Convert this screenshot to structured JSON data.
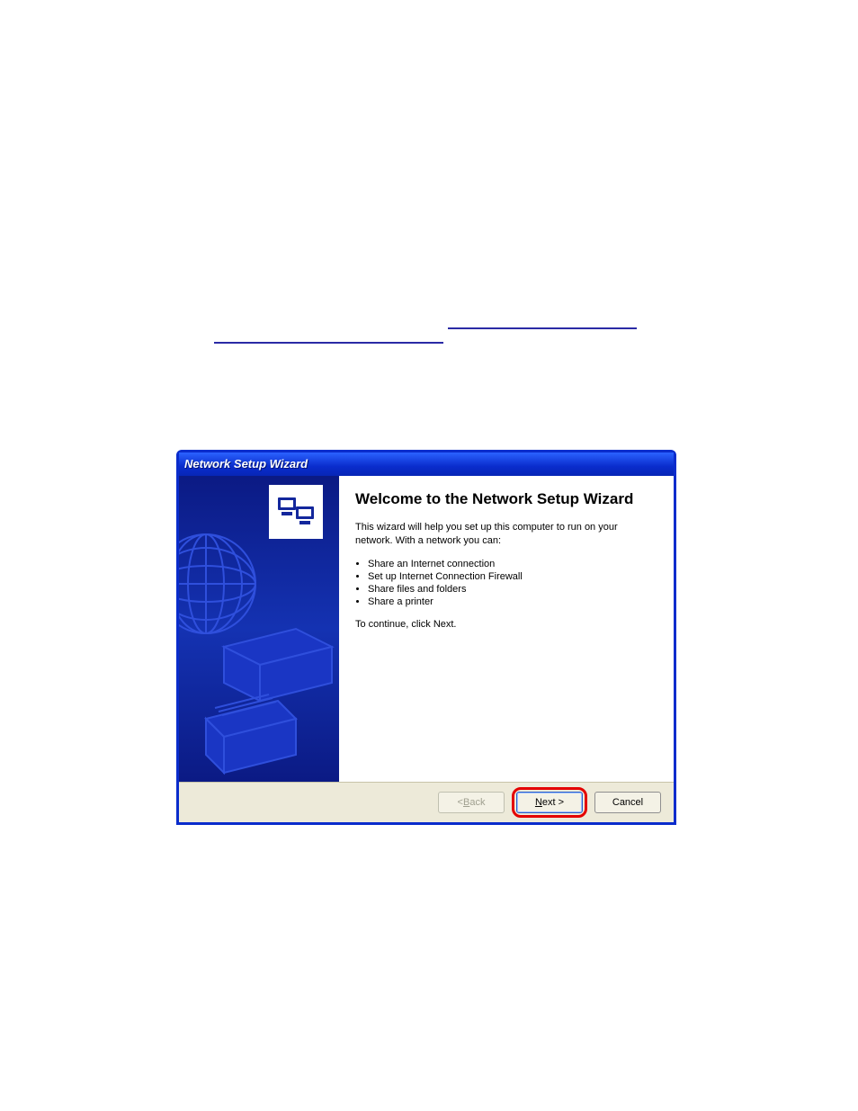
{
  "wizard": {
    "title": "Network Setup Wizard",
    "heading": "Welcome to the Network Setup Wizard",
    "intro": "This wizard will help you set up this computer to run on your network. With a network you can:",
    "bullets": [
      "Share an Internet connection",
      "Set up Internet Connection Firewall",
      "Share files and folders",
      "Share a printer"
    ],
    "continue_text": "To continue, click Next.",
    "buttons": {
      "back_prefix": "< ",
      "back_letter": "B",
      "back_suffix": "ack",
      "next_letter": "N",
      "next_suffix": "ext >",
      "cancel": "Cancel"
    }
  }
}
